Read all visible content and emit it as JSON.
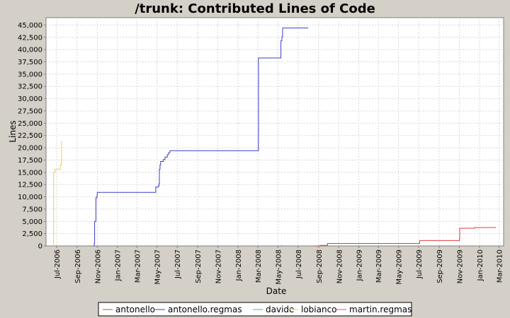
{
  "chart_data": {
    "type": "line",
    "title": "/trunk: Contributed Lines of Code",
    "xlabel": "Date",
    "ylabel": "Lines",
    "ylim": [
      0,
      46500
    ],
    "xlim": [
      "2006-05-30",
      "2010-03-15"
    ],
    "y_ticks": [
      0,
      2500,
      5000,
      7500,
      10000,
      12500,
      15000,
      17500,
      20000,
      22500,
      25000,
      27500,
      30000,
      32500,
      35000,
      37500,
      40000,
      42500,
      45000
    ],
    "y_tick_labels": [
      "0",
      "2,500",
      "5,000",
      "7,500",
      "10,000",
      "12,500",
      "15,000",
      "17,500",
      "20,000",
      "22,500",
      "25,000",
      "27,500",
      "30,000",
      "32,500",
      "35,000",
      "37,500",
      "40,000",
      "42,500",
      "45,000"
    ],
    "x_ticks": [
      "2006-07-01",
      "2006-09-01",
      "2006-11-01",
      "2007-01-01",
      "2007-03-01",
      "2007-05-01",
      "2007-07-01",
      "2007-09-01",
      "2007-11-01",
      "2008-01-01",
      "2008-03-01",
      "2008-05-01",
      "2008-07-01",
      "2008-09-01",
      "2008-11-01",
      "2009-01-01",
      "2009-03-01",
      "2009-05-01",
      "2009-07-01",
      "2009-09-01",
      "2009-11-01",
      "2010-01-01",
      "2010-03-01"
    ],
    "x_tick_labels": [
      "Jul-2006",
      "Sep-2006",
      "Nov-2006",
      "Jan-2007",
      "Mar-2007",
      "May-2007",
      "Jul-2007",
      "Sep-2007",
      "Nov-2007",
      "Jan-2008",
      "Mar-2008",
      "May-2008",
      "Jul-2008",
      "Sep-2008",
      "Nov-2008",
      "Jan-2009",
      "Mar-2009",
      "May-2009",
      "Jul-2009",
      "Sep-2009",
      "Nov-2009",
      "Jan-2010",
      "Mar-2010"
    ],
    "grid": true,
    "legend_position": "bottom",
    "series": [
      {
        "name": "antonello",
        "color": "#e03c3c",
        "points": [
          [
            "2008-08-18",
            0
          ],
          [
            "2008-09-05",
            100
          ],
          [
            "2008-09-25",
            150
          ],
          [
            "2008-09-28",
            500
          ],
          [
            "2009-07-03",
            500
          ],
          [
            "2009-07-04",
            1100
          ],
          [
            "2009-10-28",
            1100
          ],
          [
            "2009-11-01",
            1500
          ],
          [
            "2009-11-02",
            3600
          ],
          [
            "2009-12-15",
            3600
          ],
          [
            "2009-12-17",
            3750
          ],
          [
            "2010-02-20",
            3750
          ]
        ]
      },
      {
        "name": "antonello.regmas",
        "color": "#3c3cc8",
        "points": [
          [
            "2006-10-20",
            0
          ],
          [
            "2006-10-23",
            500
          ],
          [
            "2006-10-24",
            5000
          ],
          [
            "2006-10-27",
            5000
          ],
          [
            "2006-10-28",
            9800
          ],
          [
            "2006-10-31",
            10200
          ],
          [
            "2006-11-01",
            10900
          ],
          [
            "2007-04-25",
            10900
          ],
          [
            "2007-04-27",
            12000
          ],
          [
            "2007-05-05",
            12200
          ],
          [
            "2007-05-07",
            12700
          ],
          [
            "2007-05-08",
            15600
          ],
          [
            "2007-05-10",
            16500
          ],
          [
            "2007-05-12",
            17200
          ],
          [
            "2007-05-20",
            17600
          ],
          [
            "2007-05-25",
            18100
          ],
          [
            "2007-06-01",
            18600
          ],
          [
            "2007-06-05",
            19000
          ],
          [
            "2007-06-09",
            19400
          ],
          [
            "2008-02-28",
            19400
          ],
          [
            "2008-03-03",
            38300
          ],
          [
            "2008-05-08",
            38300
          ],
          [
            "2008-05-10",
            41800
          ],
          [
            "2008-05-13",
            42600
          ],
          [
            "2008-05-15",
            44400
          ],
          [
            "2008-08-01",
            44400
          ]
        ]
      },
      {
        "name": "davide",
        "color": "#3cc83c",
        "points": []
      },
      {
        "name": "lobianco",
        "color": "#ecd24a",
        "points": [
          [
            "2006-06-21",
            0
          ],
          [
            "2006-06-22",
            15000
          ],
          [
            "2006-06-26",
            15600
          ],
          [
            "2006-07-10",
            15600
          ],
          [
            "2006-07-12",
            16500
          ],
          [
            "2006-07-15",
            16800
          ],
          [
            "2006-07-16",
            21400
          ]
        ]
      },
      {
        "name": "martin.regmas",
        "color": "#e04aa8",
        "points": [
          [
            "2008-05-10",
            0
          ],
          [
            "2008-05-12",
            200
          ]
        ]
      }
    ]
  }
}
